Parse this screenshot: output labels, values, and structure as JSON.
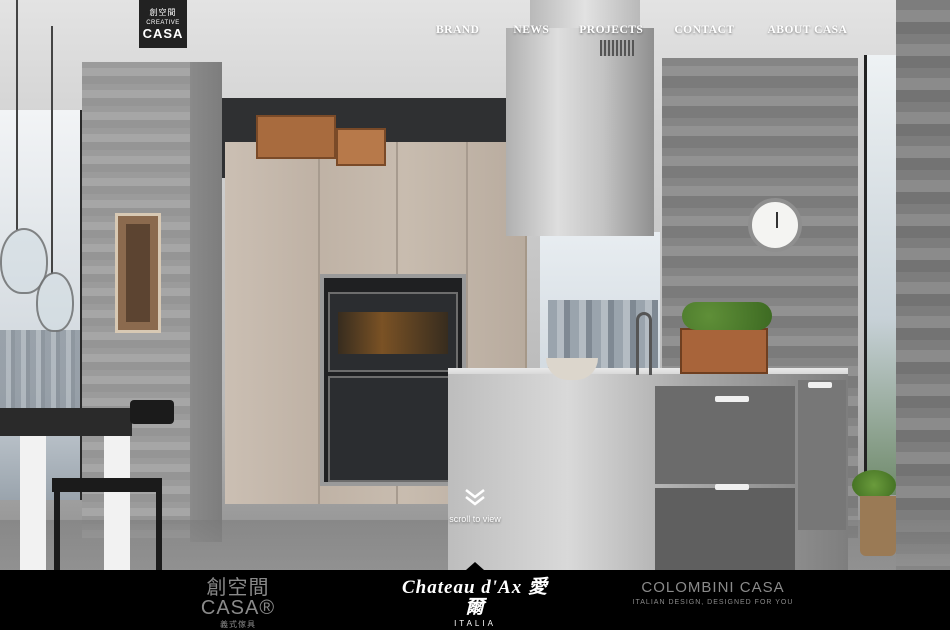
{
  "logo": {
    "top": "創空間",
    "middle": "CREATIVE",
    "bottom": "CASA"
  },
  "nav": {
    "items": [
      {
        "label": "BRAND"
      },
      {
        "label": "NEWS"
      },
      {
        "label": "PROJECTS"
      },
      {
        "label": "CONTACT"
      },
      {
        "label": "ABOUT CASA"
      }
    ]
  },
  "hero": {
    "scroll_label": "scroll to view",
    "scroll_icon": "double-chevron-down-icon"
  },
  "brands": [
    {
      "name": "創空間 CASA®",
      "sub": "義式傢具",
      "active": false
    },
    {
      "name": "Chateau d'Ax 愛爾",
      "sub": "ITALIA",
      "active": true
    },
    {
      "name": "COLOMBINI CASA",
      "sub": "ITALIAN DESIGN, DESIGNED FOR YOU",
      "active": false
    }
  ],
  "colors": {
    "bar_background": "#000000",
    "active_brand": "#ffffff",
    "inactive_brand": "#8a8a8a"
  }
}
